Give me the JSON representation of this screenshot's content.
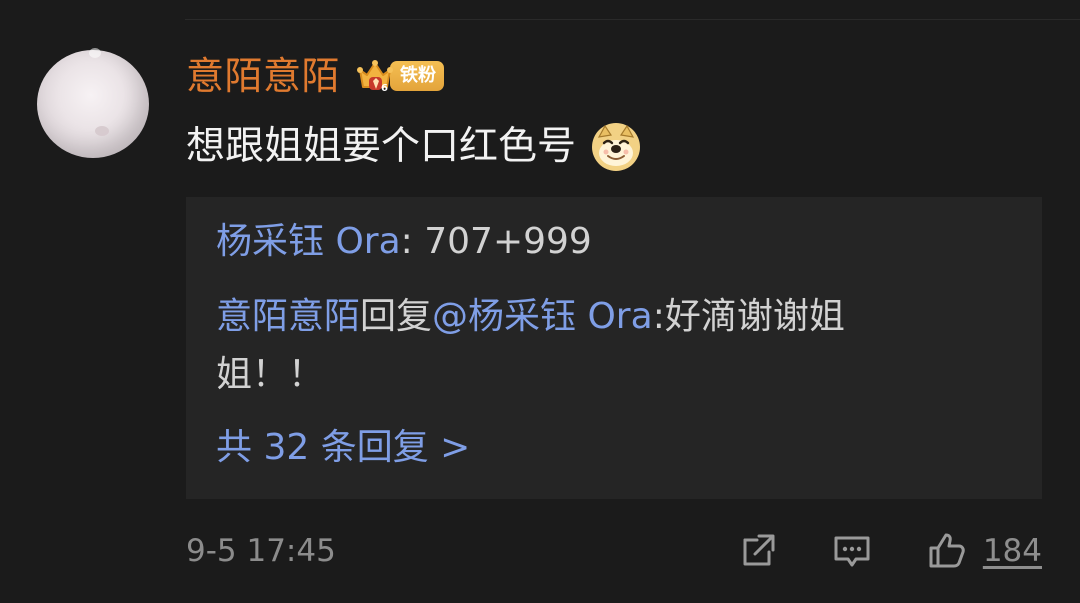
{
  "comment": {
    "username": "意陌意陌",
    "badge_label": "铁粉",
    "text": "想跟姐姐要个口红色号",
    "emoji_icon": "doge-icon"
  },
  "replies": {
    "first": {
      "author": "杨采钰 Ora",
      "separator": ": ",
      "text": "707+999"
    },
    "second": {
      "author": "意陌意陌",
      "reply_word": "回复",
      "mention": "@杨采钰 Ora",
      "text_line_1": ":好滴谢谢姐",
      "text_line_2": "姐！！"
    },
    "more_label": "共 32 条回复 >"
  },
  "meta": {
    "timestamp": "9-5 17:45",
    "like_count": "184"
  },
  "colors": {
    "background": "#1b1b1b",
    "reply_background": "#252525",
    "username": "#e07a2f",
    "link": "#7f9ee6",
    "text": "#f2f2f2",
    "secondary": "#8c8c8c"
  }
}
